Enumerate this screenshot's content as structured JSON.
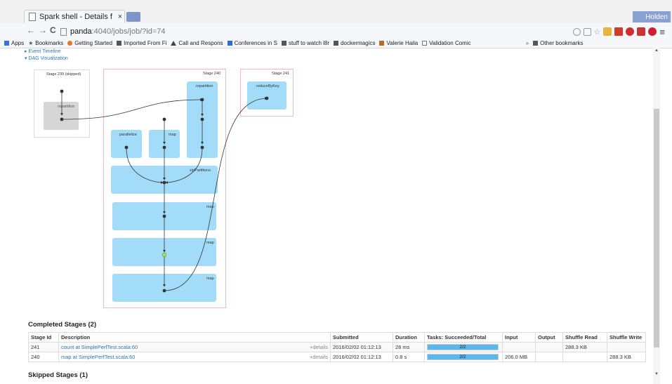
{
  "browser": {
    "tab_title": "Spark shell - Details f",
    "tab_close": "×",
    "user": "Holden",
    "url_host": "panda",
    "url_path": ":4040/jobs/job/?id=74",
    "back": "←",
    "forward": "→",
    "reload": "C",
    "menu": "≡",
    "bookmarks": [
      {
        "label": "Apps",
        "icon": "apps-icon"
      },
      {
        "label": "Bookmarks",
        "icon": "star-icon"
      },
      {
        "label": "Getting Started",
        "icon": "firefox-icon"
      },
      {
        "label": "Imported From Fi",
        "icon": "folder-icon"
      },
      {
        "label": "Call and Respons",
        "icon": "drive-icon"
      },
      {
        "label": "Conferences in S",
        "icon": "calendar-icon"
      },
      {
        "label": "stuff to watch l8r",
        "icon": "folder-icon"
      },
      {
        "label": "dockermagics",
        "icon": "folder-icon"
      },
      {
        "label": "Valerie Haila",
        "icon": "image-icon"
      },
      {
        "label": "Validation Comic",
        "icon": "page-icon"
      }
    ],
    "overflow": "»",
    "other_bookmarks": "Other bookmarks"
  },
  "page": {
    "event_timeline": "▸ Event Timeline",
    "dag_visualization": "▾ DAG Visualization"
  },
  "dag": {
    "stage_skipped": {
      "title": "Stage 239 (skipped)",
      "ops": [
        "repartition"
      ]
    },
    "stage_240": {
      "title": "Stage 240",
      "ops": [
        "repartition",
        "parallelize",
        "map",
        "zipPartitions",
        "map",
        "map",
        "map"
      ]
    },
    "stage_241": {
      "title": "Stage 241",
      "ops": [
        "reduceByKey"
      ]
    }
  },
  "completed": {
    "title": "Completed Stages (2)",
    "headers": [
      "Stage Id",
      "Description",
      "Submitted",
      "Duration",
      "Tasks: Succeeded/Total",
      "Input",
      "Output",
      "Shuffle Read",
      "Shuffle Write"
    ],
    "rows": [
      {
        "id": "241",
        "description": "count at SimplePerfTest.scala:60",
        "details": "+details",
        "submitted": "2016/02/02 01:12:13",
        "duration": "28 ms",
        "tasks": "2/2",
        "tasks_progress": 1.0,
        "input": "",
        "output": "",
        "shuffle_read": "288.3 KB",
        "shuffle_write": ""
      },
      {
        "id": "240",
        "description": "map at SimplePerfTest.scala:60",
        "details": "+details",
        "submitted": "2016/02/02 01:12:13",
        "duration": "0.8 s",
        "tasks": "2/2",
        "tasks_progress": 1.0,
        "input": "206.0 MB",
        "output": "",
        "shuffle_read": "",
        "shuffle_write": "288.3 KB"
      }
    ]
  },
  "skipped": {
    "title": "Skipped Stages (1)"
  }
}
